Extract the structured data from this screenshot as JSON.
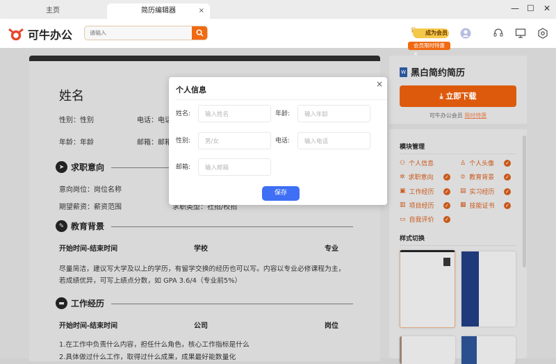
{
  "tabs": {
    "home": "主页",
    "editor": "简历编辑器",
    "close": "×"
  },
  "window": {
    "minimize": "—",
    "maximize": "☐",
    "close": "✕"
  },
  "header": {
    "logo": "可牛办公",
    "search_placeholder": "请输入",
    "vip": "成为会员",
    "promo": "会员限时特惠",
    "promo_close": "×"
  },
  "resume": {
    "name": "姓名",
    "gender": "性别：性别",
    "phone": "电话：电话",
    "age": "年龄：年龄",
    "email": "邮箱：邮箱",
    "intent": {
      "title": "求职意向",
      "position": "意向岗位：岗位名称",
      "type": "求职类型：社招/校招",
      "salary": "期望薪资：薪资范围"
    },
    "edu": {
      "title": "教育背景",
      "time": "开始时间-结束时间",
      "school": "学校",
      "major": "专业",
      "desc1": "尽量简洁，建议写大学及以上的学历，有留学交换的经历也可以写。内容以专业必修课程为主，",
      "desc2": "若成绩优异，可写上绩点分数，如 GPA 3.6/4（专业前5%）"
    },
    "work": {
      "title": "工作经历",
      "time": "开始时间-结束时间",
      "company": "公司",
      "role": "岗位",
      "line1": "1.在工作中负责什么内容，担任什么角色，核心工作指标是什么",
      "line2": "2.具体做过什么工作，取得过什么成果，成果最好能数量化"
    }
  },
  "panel": {
    "doc_title": "黑白简约简历",
    "download": "立即下载",
    "member_text": "可牛办公会员",
    "member_link": "限时特惠",
    "modules_title": "模块管理",
    "modules": [
      {
        "label": "个人信息",
        "icon": "user-icon",
        "checked": false
      },
      {
        "label": "个人头像",
        "icon": "avatar-icon",
        "checked": true
      },
      {
        "label": "求职意向",
        "icon": "target-icon",
        "checked": true
      },
      {
        "label": "教育背景",
        "icon": "graduation-icon",
        "checked": true
      },
      {
        "label": "工作经历",
        "icon": "briefcase-icon",
        "checked": true
      },
      {
        "label": "实习经历",
        "icon": "book-icon",
        "checked": true
      },
      {
        "label": "项目经历",
        "icon": "project-icon",
        "checked": true
      },
      {
        "label": "技能证书",
        "icon": "certificate-icon",
        "checked": true
      },
      {
        "label": "自我评价",
        "icon": "comment-icon",
        "checked": true
      }
    ],
    "styles_title": "样式切换"
  },
  "modal": {
    "title": "个人信息",
    "close": "×",
    "fields": [
      {
        "label": "姓名:",
        "placeholder": "输入姓名"
      },
      {
        "label": "年龄:",
        "placeholder": "输入年龄"
      },
      {
        "label": "性别:",
        "placeholder": "男/女"
      },
      {
        "label": "电话:",
        "placeholder": "输入电话"
      },
      {
        "label": "邮箱:",
        "placeholder": "输入邮箱"
      }
    ],
    "save": "保存"
  },
  "colors": {
    "accent": "#f06a12",
    "primary": "#3e6ff4",
    "module": "#c8581a"
  }
}
